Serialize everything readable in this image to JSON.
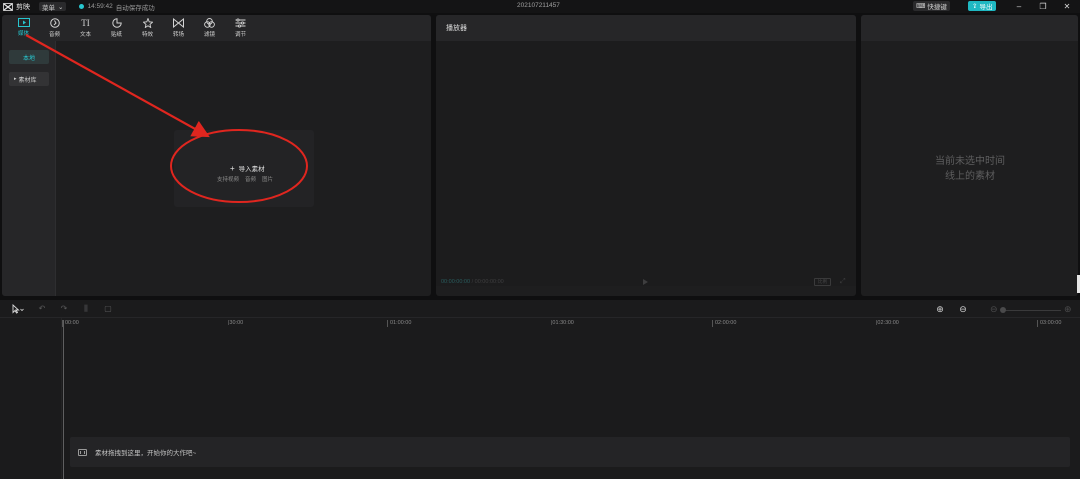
{
  "app": {
    "logo_label": "剪映",
    "menu_label": "菜单",
    "save_time": "14:59:42",
    "save_text": "自动保存成功",
    "project_title": "202107211457",
    "shortcut_label": "快捷键",
    "export_label": "导出"
  },
  "media_toolbar": {
    "items": [
      {
        "label": "媒体",
        "icon": "media-icon",
        "active": true
      },
      {
        "label": "音频",
        "icon": "audio-icon",
        "active": false
      },
      {
        "label": "文本",
        "icon": "text-icon",
        "active": false
      },
      {
        "label": "贴纸",
        "icon": "sticker-icon",
        "active": false
      },
      {
        "label": "特效",
        "icon": "effects-icon",
        "active": false
      },
      {
        "label": "转场",
        "icon": "transition-icon",
        "active": false
      },
      {
        "label": "滤镜",
        "icon": "filter-icon",
        "active": false
      },
      {
        "label": "调节",
        "icon": "adjust-icon",
        "active": false
      }
    ]
  },
  "media_sidebar": {
    "local_label": "本地",
    "library_label": "素材库"
  },
  "import": {
    "title": "导入素材",
    "types": [
      "支持视频",
      "音频",
      "图片"
    ]
  },
  "player": {
    "title": "播放器",
    "current_time": "00:00:00:00",
    "total_time": "00:00:00:00",
    "ratio_label": "比例"
  },
  "properties": {
    "empty_line1": "当前未选中时间",
    "empty_line2": "线上的素材"
  },
  "timeline": {
    "ticks": [
      "00:00",
      "|30:00",
      "01:00:00",
      "|01:30:00",
      "02:00:00",
      "|02:30:00",
      "03:00:00"
    ],
    "drop_hint": "素材拖拽到这里，开始你的大作吧~"
  },
  "colors": {
    "accent": "#27c6cf",
    "annotation": "#e0261f"
  }
}
